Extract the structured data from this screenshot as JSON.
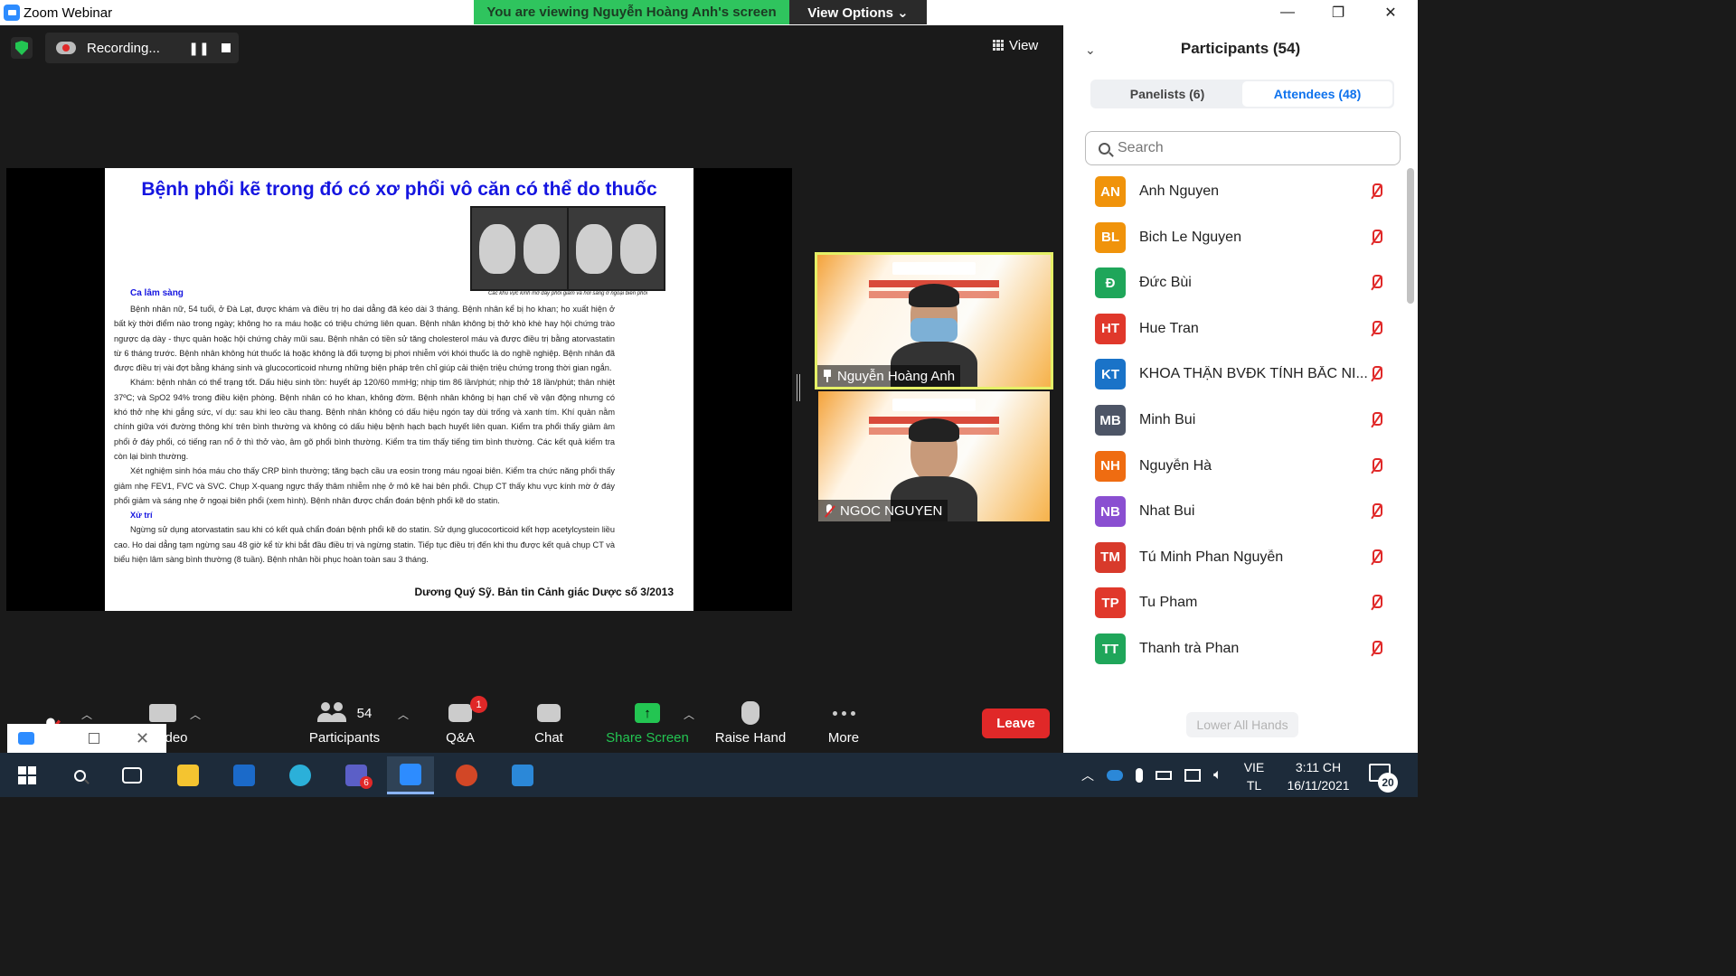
{
  "window": {
    "title": "Zoom Webinar",
    "viewing_banner": "You are viewing Nguyễn Hoàng Anh's screen",
    "view_options_label": "View Options ⌄",
    "minimize": "—",
    "restore": "❐",
    "close": "✕"
  },
  "recording": {
    "label": "Recording..."
  },
  "view_button": {
    "label": "View"
  },
  "slide": {
    "title": "Bệnh phổi kẽ trong đó có xơ phổi vô căn có thể do thuốc",
    "image_caption": "Các khu vực kính mờ đáy phổi giảm và hơi sáng ở ngoại biên phổi",
    "case_heading": "Ca lâm sàng",
    "paragraphs": [
      "Bệnh nhân nữ, 54 tuổi, ở Đà Lạt, được khám và điều trị ho dai dẳng đã kéo dài 3 tháng. Bệnh nhân kể bị ho khan; ho xuất hiện ở bất kỳ thời điểm nào trong ngày; không ho ra máu hoặc có triệu chứng liên quan. Bệnh nhân không bị thở khò khè hay hội chứng trào ngược dạ dày - thực quản hoặc hội chứng chảy mũi sau. Bệnh nhân có tiền sử tăng cholesterol máu và được điều trị bằng atorvastatin từ 6 tháng trước. Bệnh nhân không hút thuốc lá hoặc không là đối tượng bị phơi nhiễm với khói thuốc là do nghề nghiệp. Bệnh nhân đã được điều trị vài đợt bằng kháng sinh và glucocorticoid nhưng những biện pháp trên chỉ giúp cải thiện triệu chứng trong thời gian ngắn.",
      "Khám: bệnh nhân có thể trạng tốt. Dấu hiệu sinh tồn: huyết áp 120/60 mmHg; nhịp tim 86 lần/phút; nhịp thở 18 lần/phút; thân nhiệt 37ºC; và SpO2 94% trong điều kiện phòng. Bệnh nhân có ho khan, không đờm. Bệnh nhân không bị hạn chế về vận động nhưng có khó thở nhẹ khi gắng sức, ví dụ: sau khi leo cầu thang. Bệnh nhân không có dấu hiệu ngón tay dùi trống và xanh tím. Khí quản nằm chính giữa với đường thông khí trên bình thường và không có dấu hiệu bệnh hạch bạch huyết liên quan. Kiểm tra phổi thấy giảm âm phổi ở đáy phổi, có tiếng ran nổ ở thì thở vào, âm gõ phổi bình thường. Kiểm tra tim thấy tiếng tim bình thường. Các kết quả kiểm tra còn lại bình thường.",
      "Xét nghiệm sinh hóa máu cho thấy CRP bình thường; tăng bạch cầu ưa eosin trong máu ngoại biên. Kiểm tra chức năng phổi thấy giảm nhẹ FEV1, FVC và SVC. Chụp X-quang ngực thấy thâm nhiễm nhẹ ở mô kẽ hai bên phổi. Chụp CT thấy khu vực kính mờ ở đáy phổi giảm và sáng nhẹ ở ngoại biên phổi (xem hình). Bệnh nhân được chẩn đoán bệnh phổi kẽ do statin."
    ],
    "treatment_heading": "Xử trí",
    "treatment": "Ngừng sử dụng atorvastatin sau khi có kết quả chẩn đoán bệnh phổi kẽ do statin. Sử dụng glucocorticoid kết hợp acetylcystein liều cao. Ho dai dẳng tạm ngừng sau 48 giờ kể từ khi bắt đầu điều trị và ngừng statin. Tiếp tục điều trị đến khi thu được kết quả chụp CT và biểu hiện lâm sàng bình thường (8 tuần). Bệnh nhân hồi phục hoàn toàn sau 3 tháng.",
    "source": "Dương Quý Sỹ. Bản tin Cảnh giác Dược số 3/2013"
  },
  "videos": [
    {
      "name": "Nguyễn Hoàng Anh",
      "pinned": true,
      "active": true
    },
    {
      "name": "NGOC NGUYEN",
      "muted": true,
      "active": false
    }
  ],
  "toolbar": {
    "video_label": "deo",
    "participants_label": "Participants",
    "participants_count": "54",
    "qa_label": "Q&A",
    "qa_badge": "1",
    "chat_label": "Chat",
    "share_label": "Share Screen",
    "raise_label": "Raise Hand",
    "more_label": "More",
    "leave_label": "Leave"
  },
  "panel": {
    "title": "Participants (54)",
    "tab_panelists": "Panelists (6)",
    "tab_attendees": "Attendees (48)",
    "search_placeholder": "Search",
    "lower_hands": "Lower All Hands",
    "participants": [
      {
        "initials": "AN",
        "name": "Anh Nguyen",
        "color": "#f0930b"
      },
      {
        "initials": "BL",
        "name": "Bich Le Nguyen",
        "color": "#f0930b"
      },
      {
        "initials": "Đ",
        "name": "Đức Bùi",
        "color": "#1fa65a"
      },
      {
        "initials": "HT",
        "name": "Hue Tran",
        "color": "#e0382b"
      },
      {
        "initials": "KT",
        "name": "KHOA THẬN BVĐK TỈNH BẮC NI...",
        "color": "#1a73c8"
      },
      {
        "initials": "MB",
        "name": "Minh Bui",
        "color": "#4d5566"
      },
      {
        "initials": "NH",
        "name": "Nguyễn Hà",
        "color": "#ef6c11"
      },
      {
        "initials": "NB",
        "name": "Nhat Bui",
        "color": "#8a4fd1"
      },
      {
        "initials": "TM",
        "name": "Tú Minh Phan Nguyễn",
        "color": "#d83a2b"
      },
      {
        "initials": "TP",
        "name": "Tu Pham",
        "color": "#e0382b"
      },
      {
        "initials": "TT",
        "name": "Thanh trà Phan",
        "color": "#1fa65a"
      }
    ]
  },
  "taskbar": {
    "lang_top": "VIE",
    "lang_bottom": "TL",
    "time": "3:11 CH",
    "date": "16/11/2021",
    "notification_count": "20",
    "teams_badge": "6"
  }
}
